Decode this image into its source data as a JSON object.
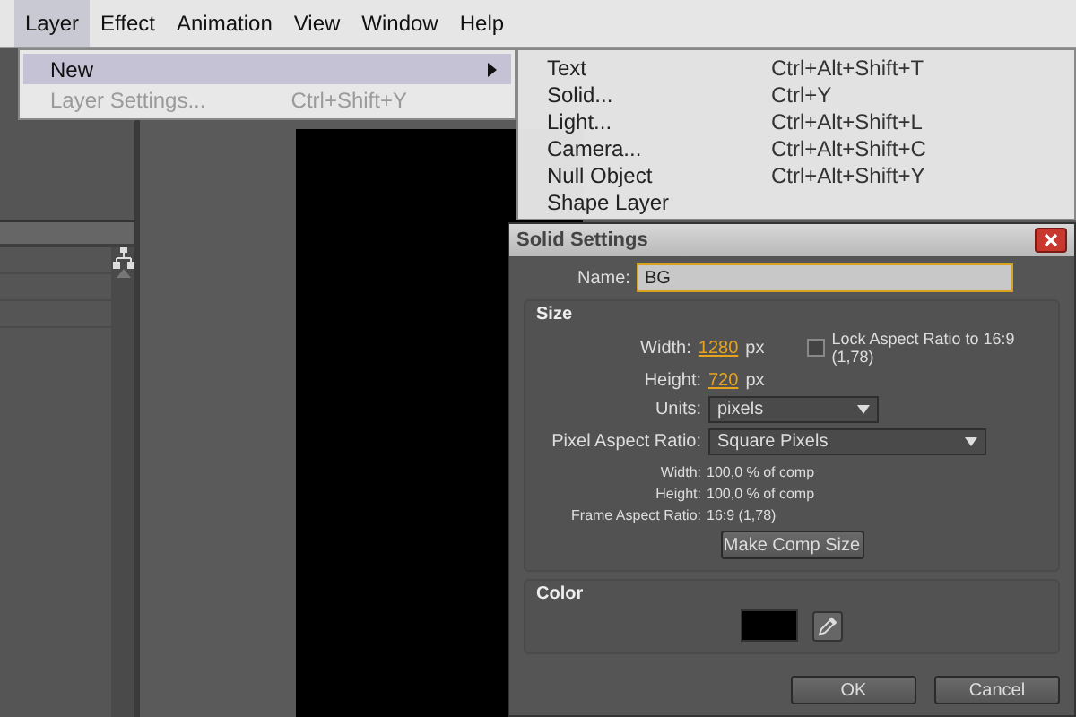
{
  "menubar": [
    {
      "label": "Layer",
      "selected": true
    },
    {
      "label": "Effect",
      "selected": false
    },
    {
      "label": "Animation",
      "selected": false
    },
    {
      "label": "View",
      "selected": false
    },
    {
      "label": "Window",
      "selected": false
    },
    {
      "label": "Help",
      "selected": false
    }
  ],
  "layer_menu": [
    {
      "label": "New",
      "kind": "submenu",
      "selected": true,
      "disabled": false
    },
    {
      "label": "Layer Settings...",
      "shortcut": "Ctrl+Shift+Y",
      "kind": "command",
      "selected": false,
      "disabled": true
    }
  ],
  "new_submenu": [
    {
      "label": "Text",
      "shortcut": "Ctrl+Alt+Shift+T"
    },
    {
      "label": "Solid...",
      "shortcut": "Ctrl+Y"
    },
    {
      "label": "Light...",
      "shortcut": "Ctrl+Alt+Shift+L"
    },
    {
      "label": "Camera...",
      "shortcut": "Ctrl+Alt+Shift+C"
    },
    {
      "label": "Null Object",
      "shortcut": "Ctrl+Alt+Shift+Y"
    },
    {
      "label": "Shape Layer"
    }
  ],
  "dialog": {
    "title": "Solid Settings",
    "name_label": "Name:",
    "name_value": "BG",
    "size": {
      "title": "Size",
      "width_label": "Width:",
      "width_value": "1280",
      "width_unit": "px",
      "height_label": "Height:",
      "height_value": "720",
      "height_unit": "px",
      "lock": {
        "label": "Lock Aspect Ratio to 16:9 (1,78)",
        "checked": false
      },
      "units_label": "Units:",
      "units_value": "pixels",
      "par_label": "Pixel Aspect Ratio:",
      "par_value": "Square Pixels",
      "info": [
        {
          "label": "Width:",
          "value": "100,0 % of comp"
        },
        {
          "label": "Height:",
          "value": "100,0 % of comp"
        },
        {
          "label": "Frame Aspect Ratio:",
          "value": "16:9 (1,78)"
        }
      ],
      "make_comp_size": "Make Comp Size"
    },
    "color": {
      "title": "Color",
      "color": "#000000"
    },
    "buttons": [
      "OK",
      "Cancel"
    ]
  }
}
